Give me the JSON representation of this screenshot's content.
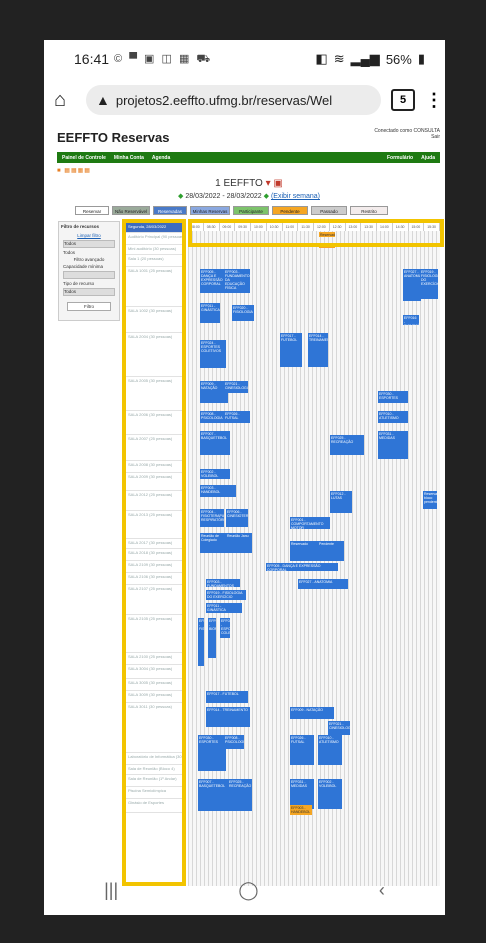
{
  "status": {
    "time": "16:41",
    "notification_icons": "© ▀ ▣ ◫ ▦ ⛟",
    "battery": "56%"
  },
  "browser": {
    "url": "projetos2.eeffto.ufmg.br/reservas/Wel",
    "tab_count": "5"
  },
  "page": {
    "app_title": "EEFFTO Reservas",
    "logged_as": "Conectado como CONSULTA",
    "logout": "Sair",
    "nav": [
      "Painel de Controle",
      "Minha Conta",
      "Agenda"
    ],
    "nav_right": [
      "Formulário",
      "Ajuda"
    ],
    "room_title": "1 EEFFTO",
    "week_range": "28/03/2022 - 28/03/2022",
    "week_link": "(Exibir semana)",
    "filters": [
      "Reservar",
      "Não Reservável",
      "Reservadas",
      "Minhas Reservas",
      "Participante",
      "Pendente",
      "Passado",
      "Restrito"
    ],
    "filter_colors": [
      "#ffffff",
      "#9aaa9a",
      "#4a7ac8",
      "#8aa8e0",
      "#7dc36b",
      "#f5a623",
      "#cccccc",
      "#f3ecec"
    ],
    "side": {
      "title": "Filtro de recursos",
      "link": "Limpar filtro",
      "all1": "Todos",
      "all2": "Todos",
      "filter_label": "Filtro avançado",
      "capacity": "Capacidade mínima",
      "type": "Tipo de recurso",
      "all3": "Todos",
      "button": "Filtro"
    },
    "rooms": [
      "Segunda, 28/03/2022",
      "Auditório Principal (90 pessoas)",
      "Mini auditório (30 pessoas)",
      "Sala 1 (20 pessoas)",
      "SALA 1001 (25 pessoas)",
      "SALA 1002 (30 pessoas)",
      "SALA 2004 (30 pessoas)",
      "SALA 2005 (30 pessoas)",
      "SALA 2006 (30 pessoas)",
      "SALA 2007 (25 pessoas)",
      "SALA 2008 (30 pessoas)",
      "SALA 2009 (30 pessoas)",
      "SALA 2012 (25 pessoas)",
      "SALA 2013 (25 pessoas)",
      "SALA 2017 (30 pessoas)",
      "SALA 2018 (30 pessoas)",
      "SALA 2109 (30 pessoas)",
      "SALA 2106 (30 pessoas)",
      "SALA 2107 (25 pessoas)",
      "SALA 2105 (25 pessoas)",
      "SALA 2100 (25 pessoas)",
      "SALA 3004 (30 pessoas)",
      "SALA 3005 (30 pessoas)",
      "SALA 3009 (30 pessoas)",
      "SALA 3011 (30 pessoas)",
      "Laboratório de Informática (30 pessoas)",
      "Sala de Reunião (Bloco 4)",
      "Sala de Reunião (1º Andar)",
      "Piscina Semiolímpica",
      "Ginásio de Esportes"
    ],
    "hours": [
      "08:00",
      "08:30",
      "09:00",
      "09:30",
      "10:00",
      "10:30",
      "11:00",
      "11:30",
      "12:00",
      "12:30",
      "13:00",
      "13:30",
      "14:00",
      "14:30",
      "15:00",
      "15:30"
    ],
    "events": [
      "Reservado",
      "Pendente",
      "EFF005 - DANÇA E EXPRESSÃO CORPORAL",
      "EFF003 - FUNDAMENTOS DA EDUCAÇÃO FÍSICA",
      "EFF027 - ANATOMIA",
      "EFF019 - FISIOLOGIA DO EXERCÍCIO",
      "EFF011 - GINÁSTICA",
      "EFF020 - FISIOLOGIA",
      "EFF016 - BIOMECÂNICA",
      "EFF024 - ESPORTES COLETIVOS",
      "EFF017 - FUTEBOL",
      "EFF014 - TREINAMENTO",
      "EFF009 - NATAÇÃO",
      "EFF021 - CINESIOLOGIA",
      "EFF030 - ESPORTES",
      "EFF008 - PSICOLOGIA",
      "EFF026 - FUTSAL",
      "EFF010 - ATLETISMO",
      "EFF007 - BASQUETEBOL",
      "EFF025 - RECREAÇÃO",
      "EFF031 - MEDIDAS",
      "EFF002 - VOLEIBOL",
      "EFF003 - HANDEBOL",
      "EFF012 - LUTAS",
      "Reserva bloco pendente",
      "EFF004 - FISIOTERAPIA RESPIRATÓRIA",
      "EFF006 - CINESIOTERAPIA",
      "EFF001 - COMPORTAMENTO MOTOR",
      "Reunião de Colegiado",
      "Reunião Janu"
    ]
  }
}
